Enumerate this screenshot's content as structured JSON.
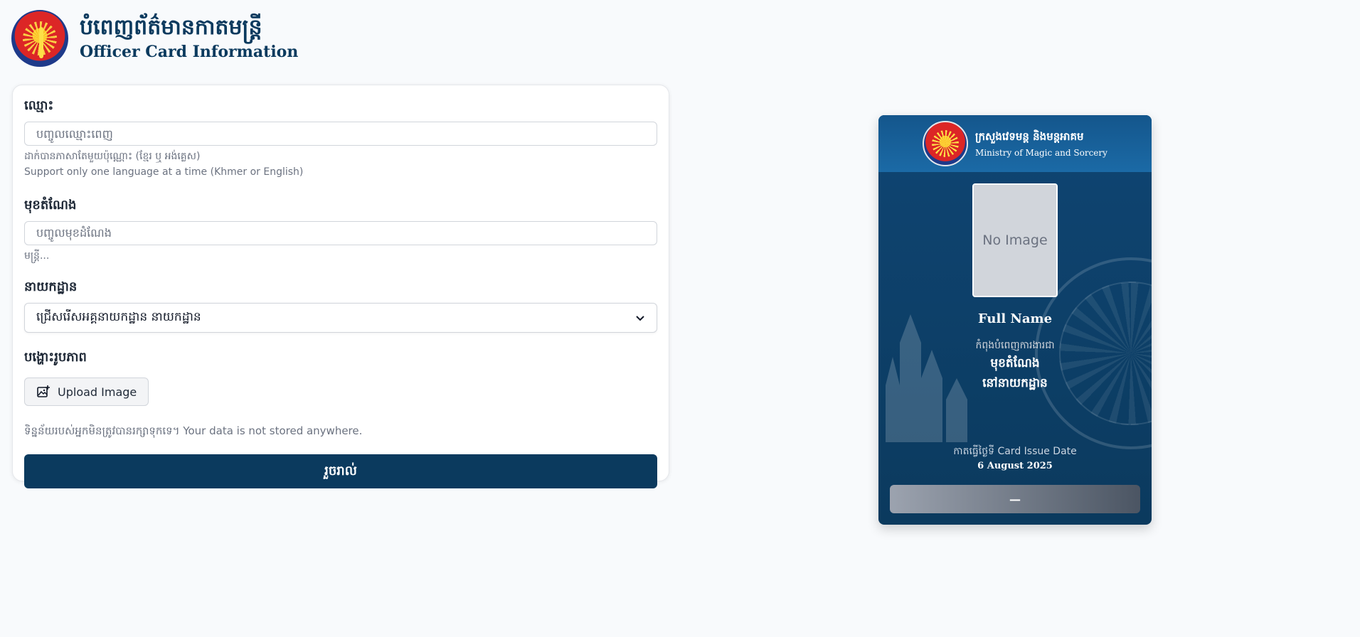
{
  "header": {
    "title_kh": "បំពេញព័ត៌មានកាតមន្ត្រី",
    "title_en": "Officer Card Information"
  },
  "form": {
    "name": {
      "label": "ឈ្មោះ",
      "placeholder": "បញ្ចូលឈ្មោះពេញ",
      "help_kh": "ដាក់បានភាសាតែមួយប៉ុណ្ណោះ (ខ្មែរ ឬ អង់គ្លេស)",
      "help_en": "Support only one language at a time (Khmer or English)"
    },
    "position": {
      "label": "មុខតំណែង",
      "placeholder": "បញ្ចូលមុខដំណែង",
      "help": "មន្ត្រី..."
    },
    "department": {
      "label": "នាយកដ្ឋាន",
      "selected": "ជ្រើសរើសអគ្គនាយកដ្ឋាន នាយកដ្ឋាន",
      "chevron_icon": "chevron-down-icon"
    },
    "upload": {
      "label": "បង្ហោះរូបភាព",
      "button_label": "Upload Image",
      "icon": "image-add-icon"
    },
    "privacy_note": "ទិន្នន័យរបស់អ្នកមិនត្រូវបានរក្សាទុកទេ។ Your data is not stored anywhere.",
    "submit_label": "រួចរាល់"
  },
  "card": {
    "ministry_kh": "ក្រសួងវេទមន្ត និងមន្តអាគម",
    "ministry_en": "Ministry of Magic and Sorcery",
    "photo_placeholder": "No Image",
    "name": "Full Name",
    "role_caption": "កំពុងបំពេញការងារជា",
    "role_title": "មុខតំណែង",
    "role_dept": "នៅនាយកដ្ឋាន",
    "issue_label": "កាតធ្វើថ្ងៃទី Card Issue Date",
    "issue_date": "6 August 2025",
    "barcode_text": "—"
  },
  "colors": {
    "primary": "#0b3a5e",
    "card_header": "#1b6aa6",
    "background": "#f8fafc"
  }
}
